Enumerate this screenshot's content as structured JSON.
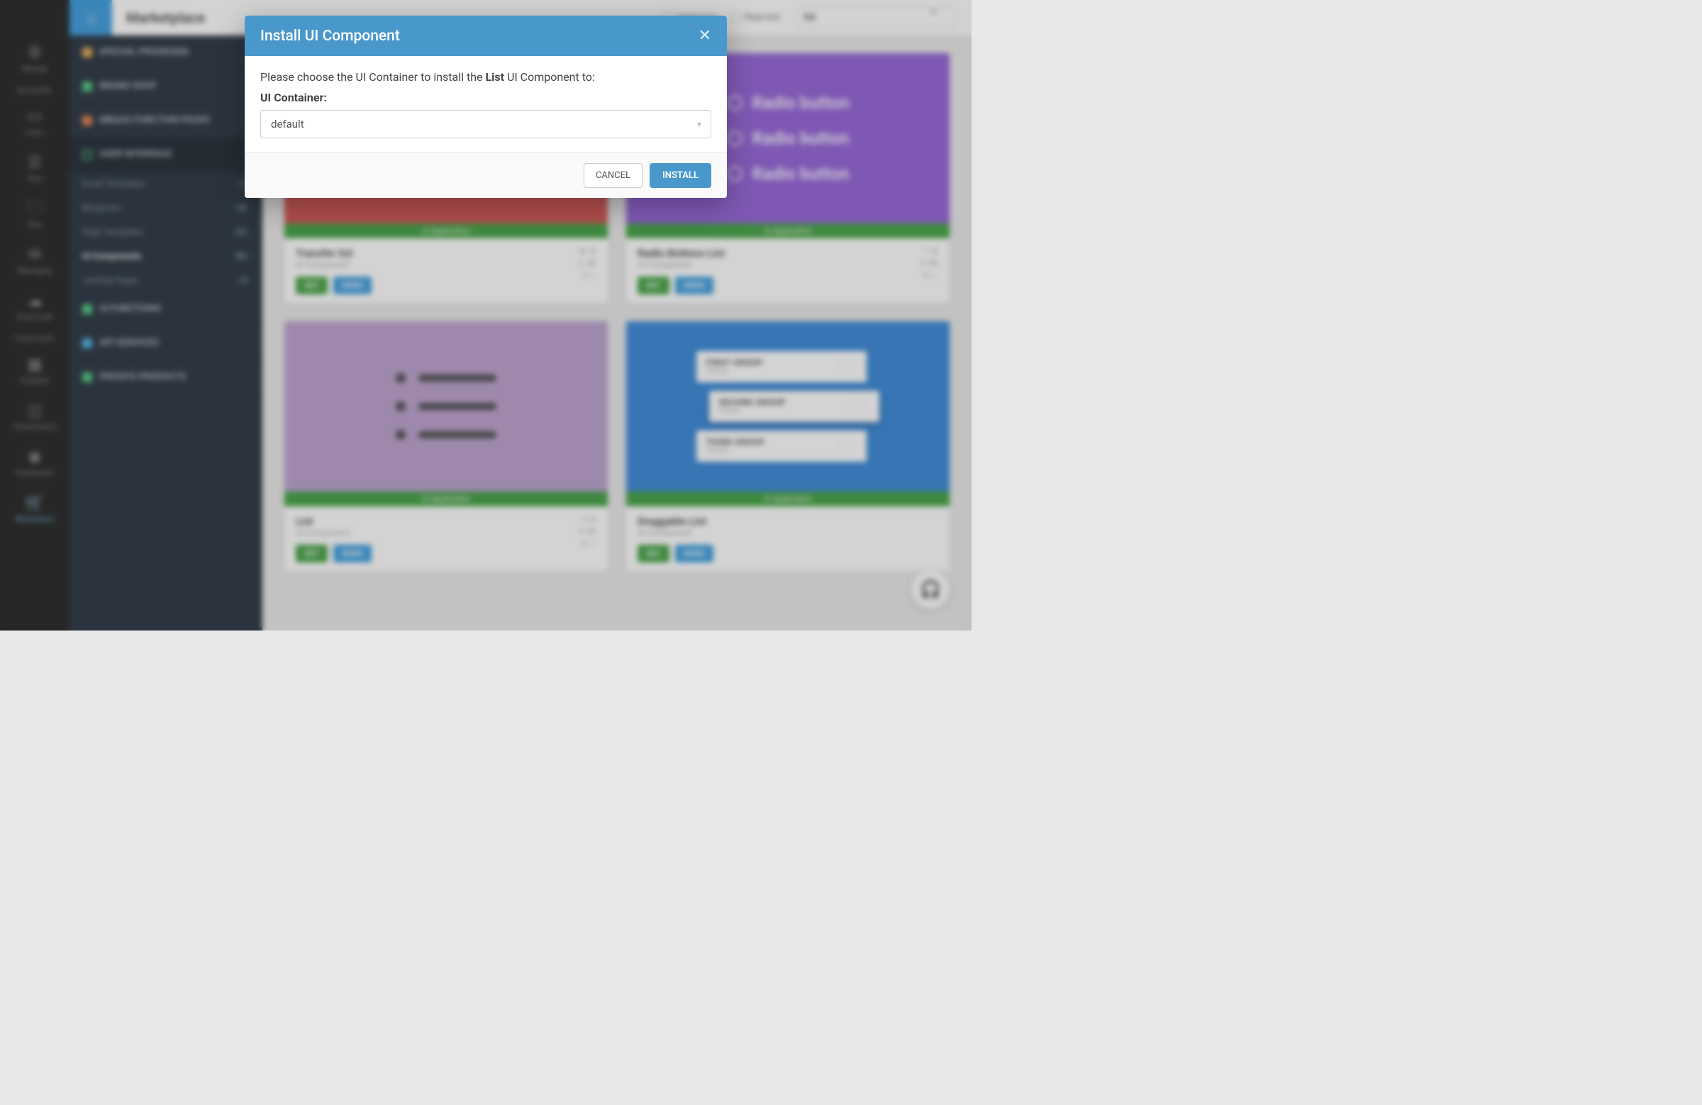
{
  "page_title": "Marketplace",
  "rail": {
    "items": [
      {
        "label": "Manage",
        "section": null
      },
      {
        "section": "BACKEND"
      },
      {
        "label": "Users"
      },
      {
        "label": "Data"
      },
      {
        "label": "Files"
      },
      {
        "label": "Messaging"
      },
      {
        "label": "Cloud Code"
      },
      {
        "section": "FRONTEND"
      },
      {
        "label": "UI Builder"
      },
      {
        "label": "Visualizations"
      },
      {
        "label": "Dashboards"
      },
      {
        "label": "Marketplace",
        "active": true
      }
    ]
  },
  "sidebar": {
    "groups": [
      {
        "label": "SPECIAL PROGRAMS",
        "color": "#e0a84a"
      },
      {
        "label": "BRAND SHOP",
        "color": "#49c77d"
      },
      {
        "label": "MBAAS FUNCTION PACKS",
        "color": "#e07a4a"
      },
      {
        "label": "USER INTERFACE",
        "color": "#49c77d",
        "expanded": true
      },
      {
        "label": "UI FUNCTIONS",
        "color": "#49c77d"
      },
      {
        "label": "API SERVICES",
        "color": "#4ab0e0"
      },
      {
        "label": "PRIVATE PRODUCTS",
        "color": "#49c77d"
      }
    ],
    "subs": [
      {
        "label": "Email Templates",
        "count": "1"
      },
      {
        "label": "Blueprints",
        "count": "18"
      },
      {
        "label": "Page Templates",
        "count": "27"
      },
      {
        "label": "UI Components",
        "count": "91",
        "active": true
      },
      {
        "label": "Landing Pages",
        "count": "4"
      }
    ]
  },
  "topbar": {
    "approved": "Approved",
    "rejected": "Rejected",
    "search_value": "list"
  },
  "cards": [
    {
      "title": "Transfer list",
      "subtitle": "UI Component",
      "tag": "⊡ Application",
      "downloads": "34",
      "views": "0",
      "likes": "0"
    },
    {
      "title": "Radio Buttons List",
      "subtitle": "UI Component",
      "tag": "⊡ Application",
      "downloads": "7",
      "views": "0",
      "likes": "0"
    },
    {
      "title": "List",
      "subtitle": "UI Component",
      "tag": "⊡ Application",
      "downloads": "3",
      "views": "0",
      "likes": "0"
    },
    {
      "title": "Draggable List",
      "subtitle": "UI Component",
      "tag": "⊡ Application",
      "downloads": "",
      "views": "",
      "likes": ""
    }
  ],
  "buttons": {
    "get": "GET",
    "demo": "DEMO"
  },
  "radio_text": "Radio button",
  "drag": {
    "g1": "FIRST GROUP",
    "g2": "SECOND GROUP",
    "g3": "THIRD GROUP",
    "details": "Details"
  },
  "modal": {
    "title": "Install UI Component",
    "prompt_pre": "Please choose the UI Container to install the ",
    "prompt_bold": "List",
    "prompt_post": " UI Component to:",
    "label": "UI Container:",
    "selected": "default",
    "cancel": "CANCEL",
    "install": "INSTALL"
  }
}
